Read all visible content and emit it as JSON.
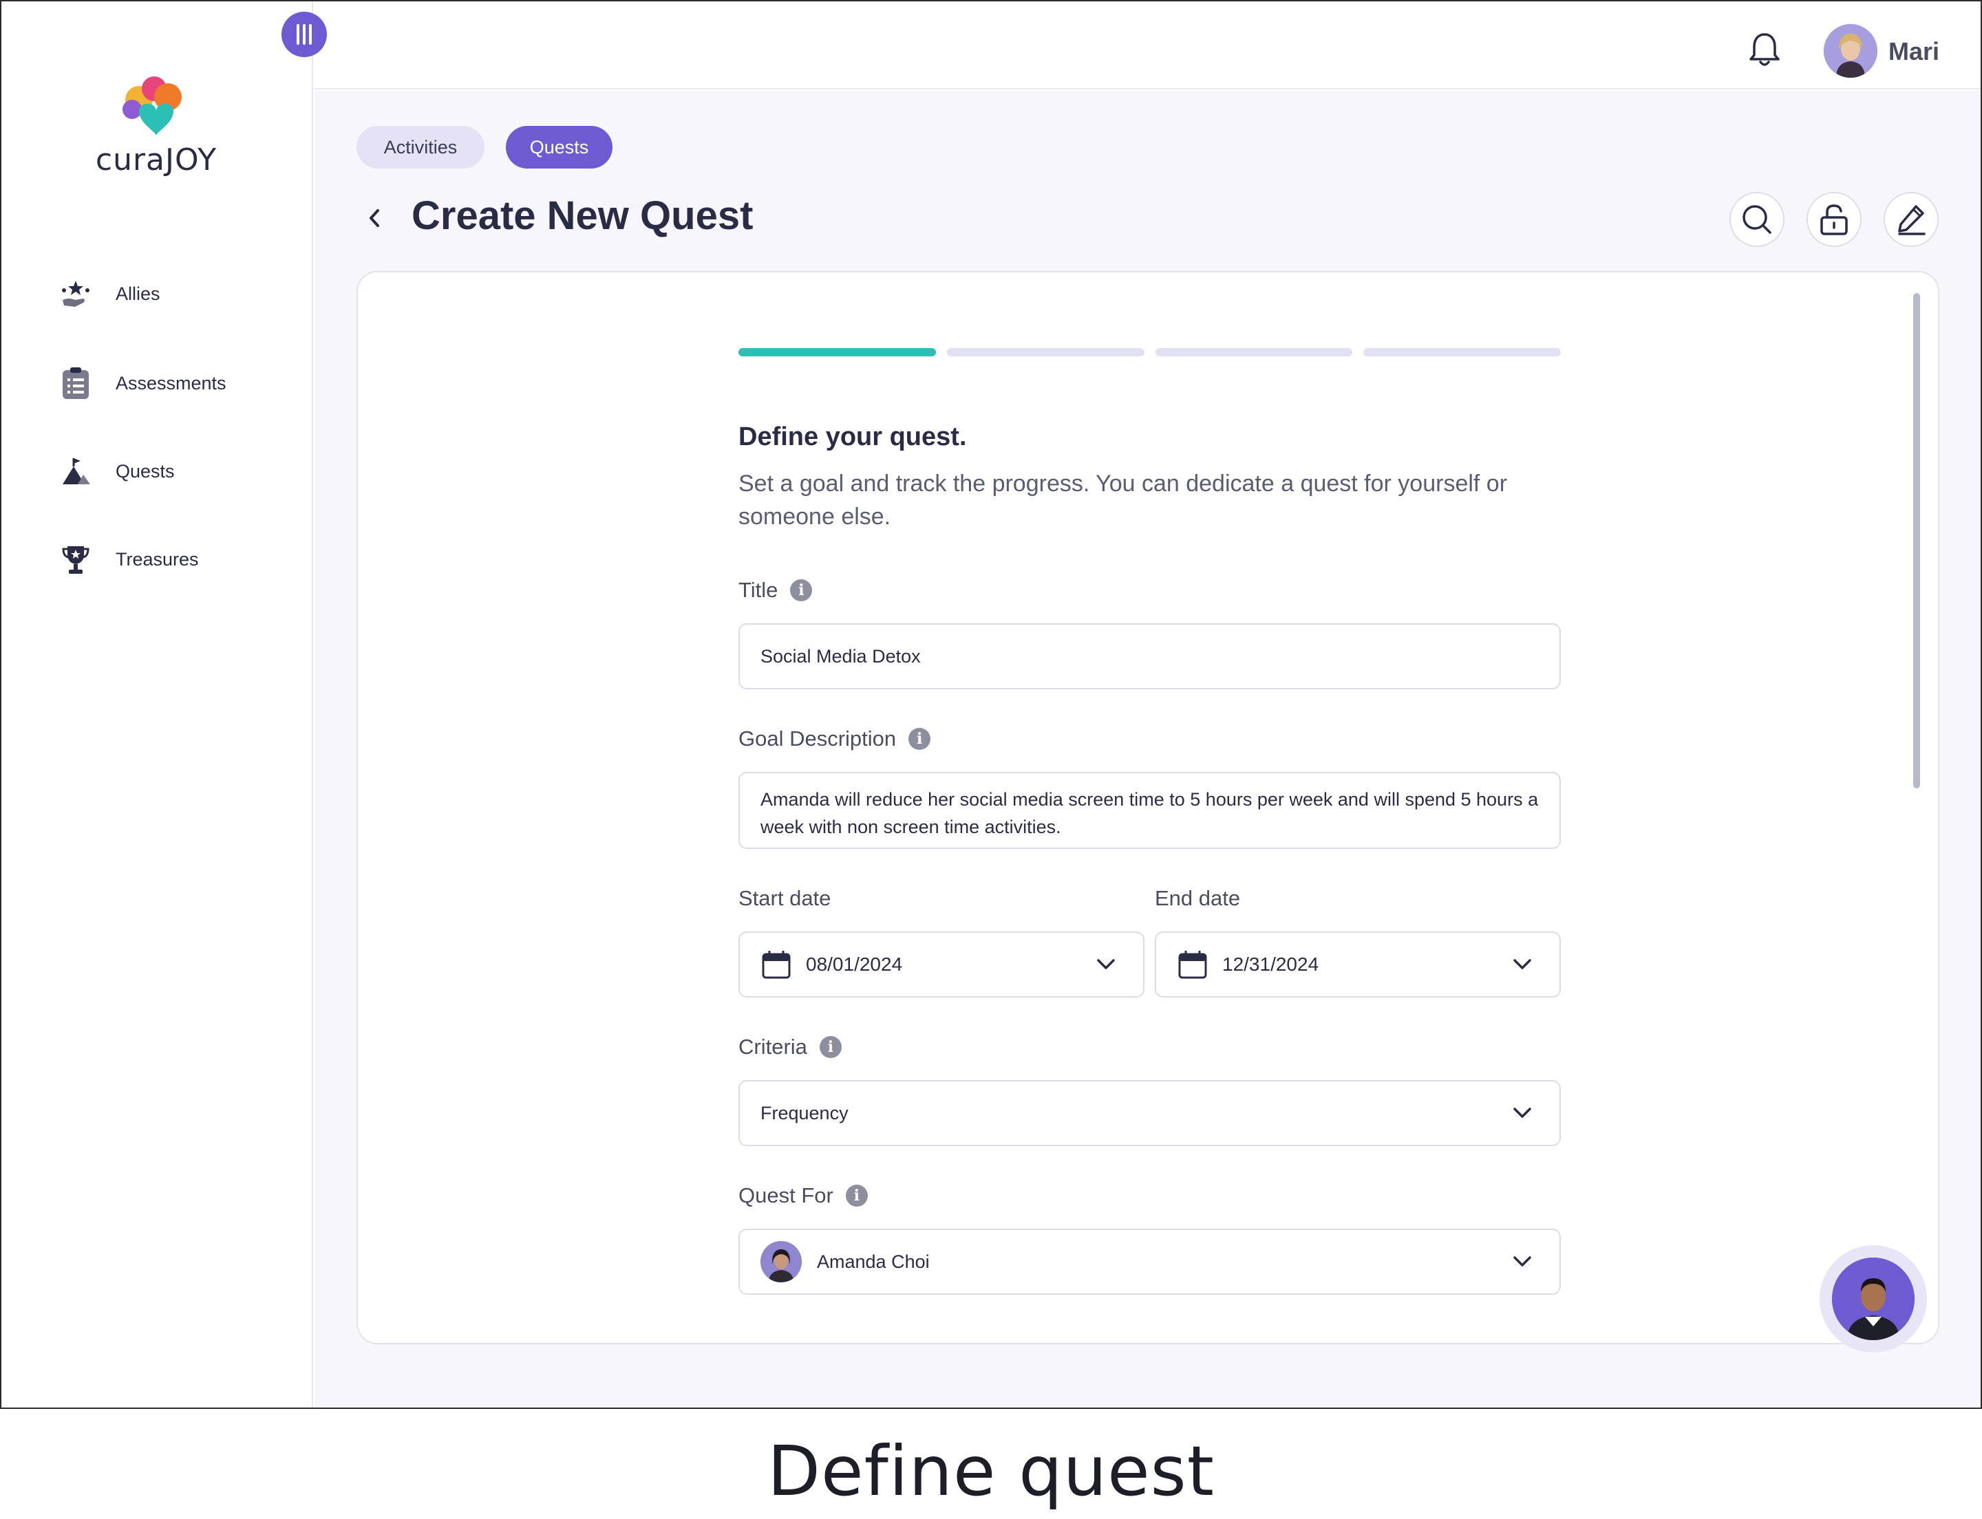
{
  "app": {
    "logo_text": "curaJOY",
    "user_name": "Mari"
  },
  "sidebar": {
    "items": [
      {
        "label": "Allies",
        "icon": "allies-icon"
      },
      {
        "label": "Assessments",
        "icon": "clipboard-icon"
      },
      {
        "label": "Quests",
        "icon": "mountain-flag-icon"
      },
      {
        "label": "Treasures",
        "icon": "trophy-icon"
      }
    ]
  },
  "tabs": {
    "activities": "Activities",
    "quests": "Quests"
  },
  "page": {
    "title": "Create New Quest"
  },
  "form": {
    "progress_steps": 4,
    "active_step": 1,
    "section_title": "Define your quest.",
    "section_subtitle": "Set a goal and track the progress. You can dedicate a quest for yourself or someone else.",
    "title_label": "Title",
    "title_value": "Social Media Detox",
    "goal_label": "Goal Description",
    "goal_value": "Amanda will reduce her social media screen time to 5 hours per week and will spend 5 hours a week with non screen time activities.",
    "start_label": "Start date",
    "start_value": "08/01/2024",
    "end_label": "End date",
    "end_value": "12/31/2024",
    "criteria_label": "Criteria",
    "criteria_value": "Frequency",
    "quest_for_label": "Quest For",
    "quest_for_value": "Amanda Choi"
  },
  "caption": "Define quest",
  "colors": {
    "accent": "#6e5bd3",
    "progress_active": "#2bbfb6",
    "progress_inactive": "#e2e0f3",
    "background": "#f6f6fc"
  }
}
